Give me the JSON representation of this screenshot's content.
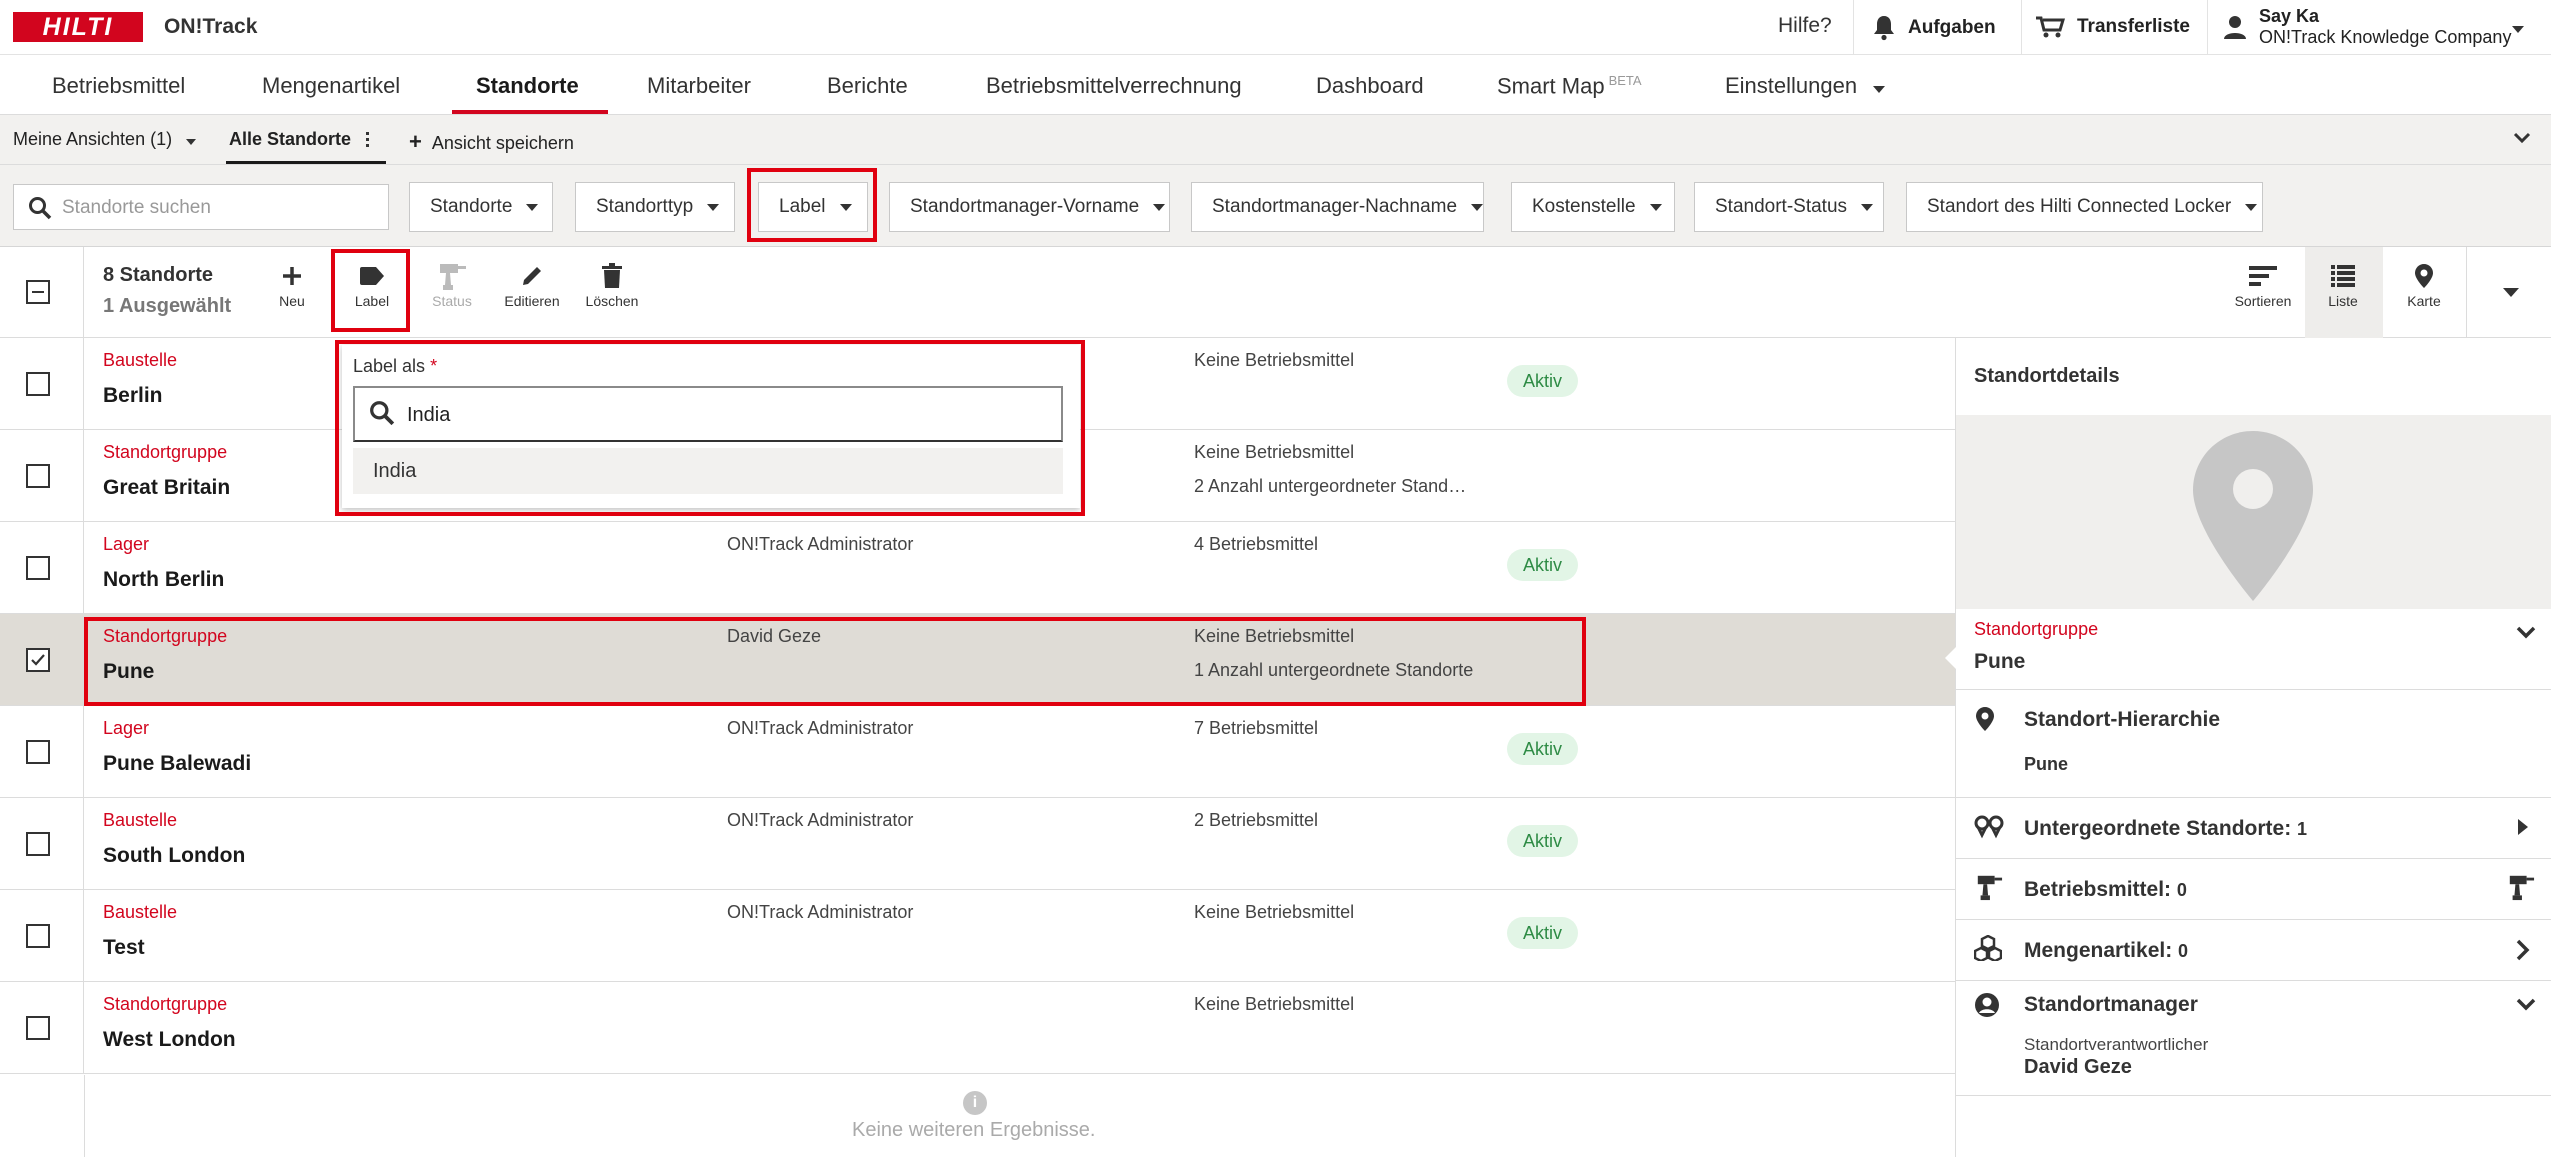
{
  "topbar": {
    "logo": "HILTI",
    "app_name": "ON!Track",
    "help": "Hilfe?",
    "tasks": "Aufgaben",
    "transfer": "Transferliste",
    "user_name": "Say Ka",
    "user_company": "ON!Track Knowledge Company"
  },
  "nav": {
    "items": [
      "Betriebsmittel",
      "Mengenartikel",
      "Standorte",
      "Mitarbeiter",
      "Berichte",
      "Betriebsmittelverrechnung",
      "Dashboard",
      "Smart Map",
      "Einstellungen"
    ],
    "beta": "BETA",
    "active": "Standorte"
  },
  "views": {
    "my_views": "Meine Ansichten (1)",
    "all": "Alle Standorte",
    "save": "Ansicht speichern"
  },
  "filters": {
    "search_placeholder": "Standorte suchen",
    "items": [
      "Standorte",
      "Standorttyp",
      "Label",
      "Standortmanager-Vorname",
      "Standortmanager-Nachname",
      "Kostenstelle",
      "Standort-Status",
      "Standort des Hilti Connected Locker"
    ]
  },
  "toolbar": {
    "count": "8 Standorte",
    "selected": "1 Ausgewählt",
    "new": "Neu",
    "label": "Label",
    "status": "Status",
    "edit": "Editieren",
    "delete": "Löschen",
    "sort": "Sortieren",
    "list": "Liste",
    "map": "Karte"
  },
  "popup": {
    "label": "Label als",
    "required": "*",
    "value": "India",
    "option": "India"
  },
  "rows": [
    {
      "type": "Baustelle",
      "name": "Berlin",
      "manager": "",
      "assets": "Keine Betriebsmittel",
      "sub": "",
      "status": "Aktiv"
    },
    {
      "type": "Standortgruppe",
      "name": "Great Britain",
      "manager": "",
      "assets": "Keine Betriebsmittel",
      "sub": "2 Anzahl untergeordneter Stand…",
      "status": ""
    },
    {
      "type": "Lager",
      "name": "North Berlin",
      "manager": "ON!Track Administrator",
      "assets": "4 Betriebsmittel",
      "sub": "",
      "status": "Aktiv"
    },
    {
      "type": "Standortgruppe",
      "name": "Pune",
      "manager": "David Geze",
      "assets": "Keine Betriebsmittel",
      "sub": "1 Anzahl untergeordnete Standorte",
      "status": ""
    },
    {
      "type": "Lager",
      "name": "Pune Balewadi",
      "manager": "ON!Track Administrator",
      "assets": "7 Betriebsmittel",
      "sub": "",
      "status": "Aktiv"
    },
    {
      "type": "Baustelle",
      "name": "South London",
      "manager": "ON!Track Administrator",
      "assets": "2 Betriebsmittel",
      "sub": "",
      "status": "Aktiv"
    },
    {
      "type": "Baustelle",
      "name": "Test",
      "manager": "ON!Track Administrator",
      "assets": "Keine Betriebsmittel",
      "sub": "",
      "status": "Aktiv"
    },
    {
      "type": "Standortgruppe",
      "name": "West London",
      "manager": "",
      "assets": "Keine Betriebsmittel",
      "sub": "",
      "status": ""
    }
  ],
  "list_footer": "Keine weiteren Ergebnisse.",
  "detail": {
    "title": "Standortdetails",
    "type": "Standortgruppe",
    "name": "Pune",
    "hierarchy_label": "Standort-Hierarchie",
    "hierarchy_value": "Pune",
    "children_label": "Untergeordnete Standorte:",
    "children_count": "1",
    "assets_label": "Betriebsmittel:",
    "assets_count": "0",
    "commodities_label": "Mengenartikel:",
    "commodities_count": "0",
    "manager_label": "Standortmanager",
    "manager_role": "Standortverantwortlicher",
    "manager_name": "David Geze"
  },
  "colors": {
    "brand": "#d2051e",
    "active_badge_bg": "#e2f5e6",
    "active_badge_text": "#2e8b45",
    "selected_row": "#dfdcd6",
    "highlight": "#e0000f"
  }
}
